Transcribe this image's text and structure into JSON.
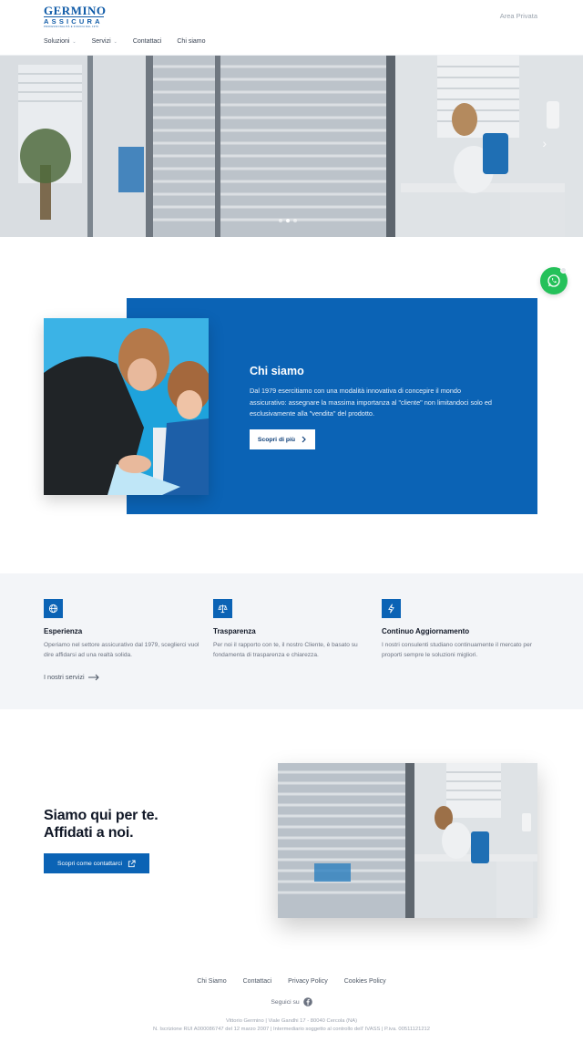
{
  "brand": {
    "name": "GERMINO",
    "sub": "ASSICURA",
    "tagline": "PROFESSIONALITÀ E FIDUCIA DAL 1979"
  },
  "header": {
    "area_privata": "Area Privata",
    "nav": [
      {
        "label": "Soluzioni",
        "dropdown": true
      },
      {
        "label": "Servizi",
        "dropdown": true
      },
      {
        "label": "Contattaci",
        "dropdown": false
      },
      {
        "label": "Chi siamo",
        "dropdown": false
      }
    ]
  },
  "hero": {
    "slides": 3,
    "active_slide": 2
  },
  "chi_siamo": {
    "title": "Chi siamo",
    "text": "Dal 1979 esercitiamo con una modalità innovativa di concepire il mondo assicurativo: assegnare la massima importanza al \"cliente\" non limitandoci solo ed esclusivamente alla \"vendita\" del prodotto.",
    "button": "Scopri di più"
  },
  "features": {
    "items": [
      {
        "icon": "globe-icon",
        "title": "Esperienza",
        "text": "Operiamo nel settore assicurativo dal 1979, sceglierci vuol dire affidarsi ad una realtà solida."
      },
      {
        "icon": "scale-icon",
        "title": "Trasparenza",
        "text": "Per noi il rapporto con te, il nostro Cliente, è basato su fondamenta di trasparenza e chiarezza."
      },
      {
        "icon": "lightning-icon",
        "title": "Continuo Aggiornamento",
        "text": "I nostri consulenti studiano continuamente il mercato per proporti sempre le soluzioni migliori."
      }
    ],
    "link": "I nostri servizi"
  },
  "contact": {
    "title_line1": "Siamo qui per te.",
    "title_line2": "Affidati a noi.",
    "button": "Scopri come contattarci"
  },
  "footer": {
    "links": [
      "Chi Siamo",
      "Contattaci",
      "Privacy Policy",
      "Cookies Policy"
    ],
    "follow": "Seguici su",
    "legal1": "Vittorio Germino | Viale Gandhi 17 - 80040 Cercola (NA)",
    "legal2": "N. Iscrizione RUI A000086747 del 12 marzo 2007 | Intermediario soggetto al controllo dell' IVASS | P.iva. 00511121212"
  },
  "colors": {
    "primary": "#0b63b5",
    "whatsapp": "#25c15a",
    "light_bg": "#f3f5f8"
  }
}
